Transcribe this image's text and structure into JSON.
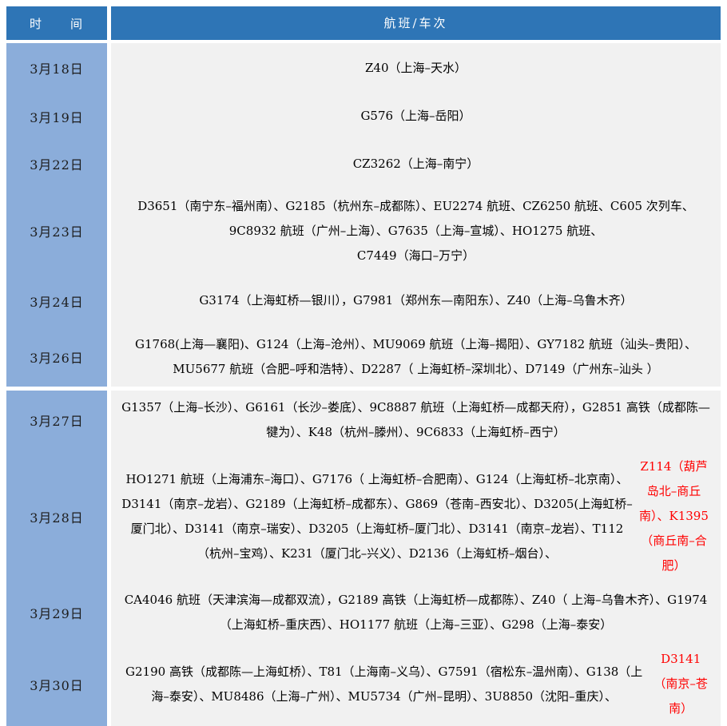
{
  "table": {
    "header": {
      "time_label": "时　　间",
      "flights_label": "航班/车次"
    },
    "rows": [
      {
        "date": "3月18日",
        "text": "Z40（上海–天水）",
        "text_red": ""
      },
      {
        "date": "3月19日",
        "text": "G576（上海–岳阳）",
        "text_red": ""
      },
      {
        "date": "3月22日",
        "text": "CZ3262（上海–南宁）",
        "text_red": ""
      },
      {
        "date": "3月23日",
        "text": "D3651（南宁东–福州南）、G2185（杭州东–成都陈）、EU2274 航班、CZ6250 航班、C605 次列车、9C8932 航班（广州–上海）、G7635（上海–宣城）、HO1275 航班、\nC7449（海口–万宁）",
        "text_red": ""
      },
      {
        "date": "3月24日",
        "text": "G3174（上海虹桥—银川），G7981（郑州东—南阳东）、Z40（上海–乌鲁木齐）",
        "text_red": ""
      },
      {
        "date": "3月26日",
        "text": "G1768(上海—襄阳)、G124（上海–沧州）、MU9069 航班（上海–揭阳）、GY7182 航班（汕头–贵阳）、MU5677 航班（合肥–呼和浩特）、D2287（ 上海虹桥–深圳北）、D7149（广州东–汕头 ）",
        "text_red": ""
      },
      {
        "date": "3月27日",
        "text": "G1357（上海–长沙）、G6161（长沙–娄底）、9C8887 航班（上海虹桥—成都天府），G2851 高铁（成都陈—犍为）、K48（杭州–滕州）、9C6833（上海虹桥–西宁）",
        "text_red": ""
      },
      {
        "date": "3月28日",
        "text": "HO1271 航班（上海浦东–海口）、G7176（ 上海虹桥–合肥南）、G124（上海虹桥–北京南）、D3141（南京–龙岩）、G2189（上海虹桥–成都东）、G869（苍南–西安北）、D3205(上海虹桥–厦门北）、D3141（南京–瑞安）、D3205（上海虹桥–厦门北）、D3141（南京–龙岩）、T112（杭州–宝鸡）、K231（厦门北–兴义）、D2136（上海虹桥–烟台）、",
        "text_red": "Z114（葫芦岛北–商丘南）、K1395（商丘南–合肥）"
      },
      {
        "date": "3月29日",
        "text": "CA4046 航班（天津滨海—成都双流），G2189 高铁（上海虹桥—成都陈）、Z40（ 上海–乌鲁木齐）、G1974（上海虹桥–重庆西）、HO1177 航班（上海–三亚）、G298（上海–泰安）",
        "text_red": ""
      },
      {
        "date": "3月30日",
        "text": "G2190 高铁（成都陈—上海虹桥）、T81（上海南–义乌）、G7591（宿松东–温州南）、G138（上海–泰安）、MU8486（上海–广州）、MU5734（广州–昆明）、3U8850（沈阳–重庆）、",
        "text_red": "D3141（南京–苍南）"
      }
    ]
  },
  "colors": {
    "header_bg": "#2e75b6",
    "date_column_bg": "#8badda",
    "content_bg": "#f1f1f1",
    "highlight_red": "#ff0000"
  }
}
